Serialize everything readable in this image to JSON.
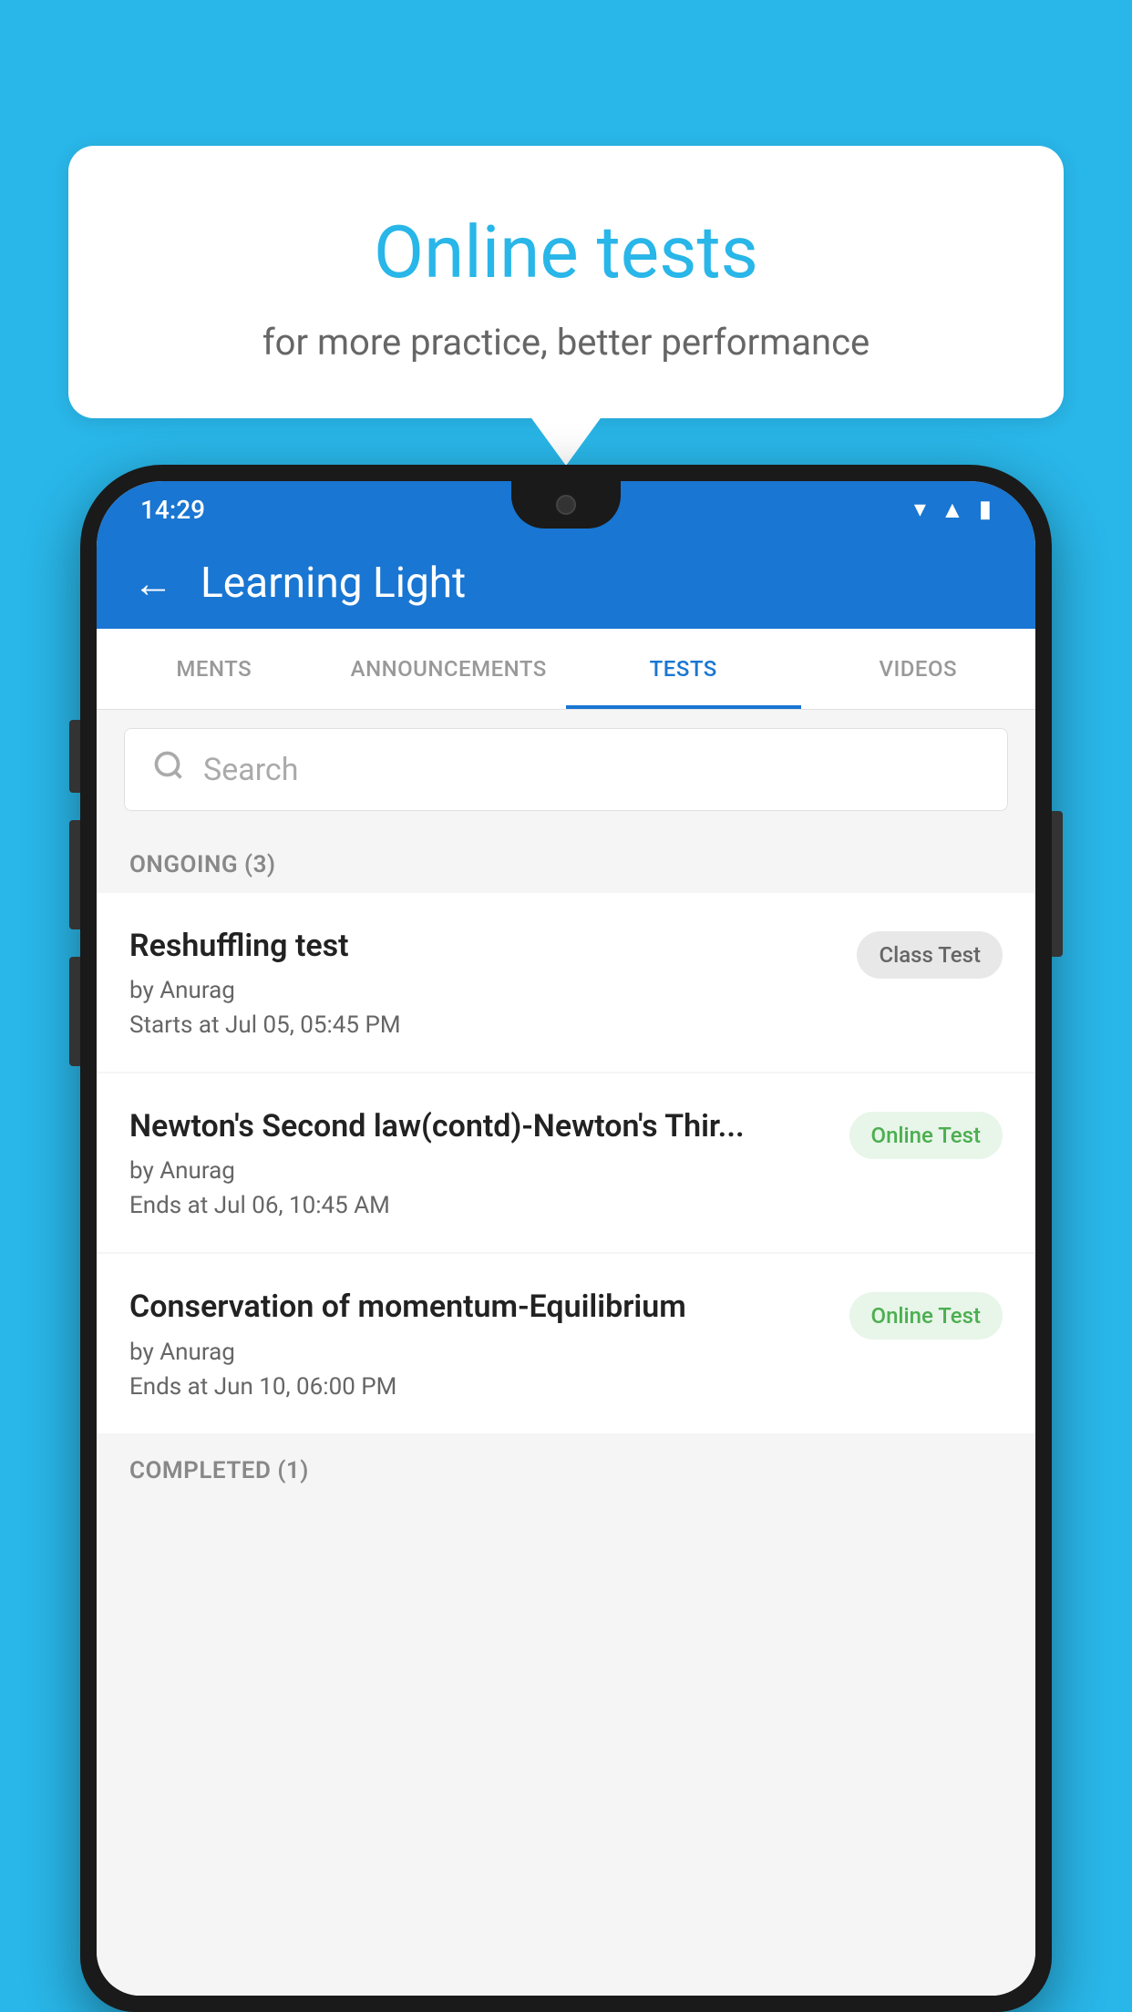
{
  "background_color": "#29B6E8",
  "promo": {
    "title": "Online tests",
    "subtitle": "for more practice, better performance"
  },
  "phone": {
    "status_bar": {
      "time": "14:29",
      "icons": [
        "wifi",
        "signal",
        "battery"
      ]
    },
    "app_bar": {
      "title": "Learning Light",
      "back_label": "←"
    },
    "tabs": [
      {
        "label": "MENTS",
        "active": false
      },
      {
        "label": "ANNOUNCEMENTS",
        "active": false
      },
      {
        "label": "TESTS",
        "active": true
      },
      {
        "label": "VIDEOS",
        "active": false
      }
    ],
    "search": {
      "placeholder": "Search"
    },
    "ongoing_section": {
      "label": "ONGOING (3)",
      "items": [
        {
          "name": "Reshuffling test",
          "author": "by Anurag",
          "time_label": "Starts at",
          "time": "Jul 05, 05:45 PM",
          "badge": "Class Test",
          "badge_type": "class"
        },
        {
          "name": "Newton's Second law(contd)-Newton's Thir...",
          "author": "by Anurag",
          "time_label": "Ends at",
          "time": "Jul 06, 10:45 AM",
          "badge": "Online Test",
          "badge_type": "online"
        },
        {
          "name": "Conservation of momentum-Equilibrium",
          "author": "by Anurag",
          "time_label": "Ends at",
          "time": "Jun 10, 06:00 PM",
          "badge": "Online Test",
          "badge_type": "online"
        }
      ]
    },
    "completed_section": {
      "label": "COMPLETED (1)"
    }
  }
}
